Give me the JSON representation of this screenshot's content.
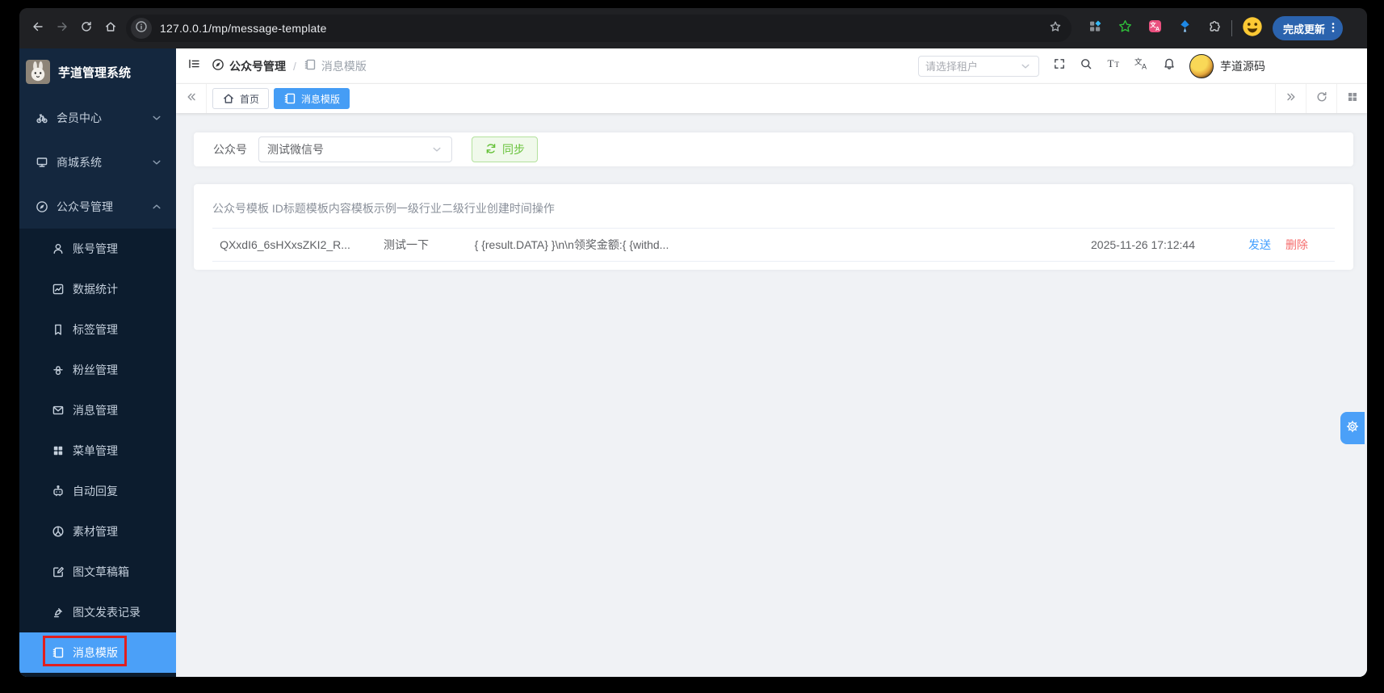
{
  "colors": {
    "accent": "#409eff",
    "tab_active": "#459df5",
    "sidebar_active": "#4ba0f8",
    "success": "#67c23a",
    "danger": "#f56c6c",
    "sidebar_bg": "#14273e",
    "submenu_bg": "#0c1c2e",
    "annotation_red": "#e01f1f"
  },
  "browser": {
    "url": "127.0.0.1/mp/message-template",
    "update_label": "完成更新",
    "extension_icons": [
      "extension-grid-icon",
      "extension-star-icon",
      "extension-translate-icon",
      "extension-balloon-icon",
      "extensions-puzzle-icon"
    ]
  },
  "sidebar": {
    "app_title": "芋道管理系统",
    "top_items": [
      {
        "label": "会员中心",
        "icon": "member-center-icon",
        "expanded": false
      },
      {
        "label": "商城系统",
        "icon": "mall-system-icon",
        "expanded": false
      },
      {
        "label": "公众号管理",
        "icon": "official-account-icon",
        "expanded": true
      }
    ],
    "sub_items": [
      {
        "label": "账号管理",
        "icon": "account-icon"
      },
      {
        "label": "数据统计",
        "icon": "statistics-icon"
      },
      {
        "label": "标签管理",
        "icon": "tag-icon"
      },
      {
        "label": "粉丝管理",
        "icon": "fans-icon"
      },
      {
        "label": "消息管理",
        "icon": "message-icon"
      },
      {
        "label": "菜单管理",
        "icon": "menu-grid-icon"
      },
      {
        "label": "自动回复",
        "icon": "auto-reply-icon"
      },
      {
        "label": "素材管理",
        "icon": "material-icon"
      },
      {
        "label": "图文草稿箱",
        "icon": "draft-icon"
      },
      {
        "label": "图文发表记录",
        "icon": "publish-record-icon"
      },
      {
        "label": "消息模版",
        "icon": "template-icon",
        "active": true
      }
    ]
  },
  "header": {
    "breadcrumb": [
      {
        "label": "公众号管理",
        "icon": "official-account-icon"
      },
      {
        "label": "消息模版",
        "icon": "template-icon"
      }
    ],
    "separator": "/",
    "tenant_placeholder": "请选择租户",
    "username": "芋道源码"
  },
  "tabs": [
    {
      "label": "首页",
      "icon": "home-icon",
      "active": false
    },
    {
      "label": "消息模版",
      "icon": "template-icon",
      "active": true
    }
  ],
  "filter": {
    "label": "公众号",
    "account_value": "测试微信号",
    "sync_label": "同步"
  },
  "table": {
    "columns": [
      "公众号模板 ID",
      "标题",
      "模板内容",
      "模板示例",
      "一级行业",
      "二级行业",
      "创建时间",
      "操作"
    ],
    "rows": [
      {
        "template_id": "QXxdI6_6sHXxsZKI2_R...",
        "title": "测试一下",
        "content": "{ {result.DATA} }\\n\\n领奖金额:{ {withd...",
        "example": "",
        "industry_primary": "",
        "industry_secondary": "",
        "created": "2025-11-26 17:12:44",
        "send_label": "发送",
        "delete_label": "删除"
      }
    ]
  }
}
